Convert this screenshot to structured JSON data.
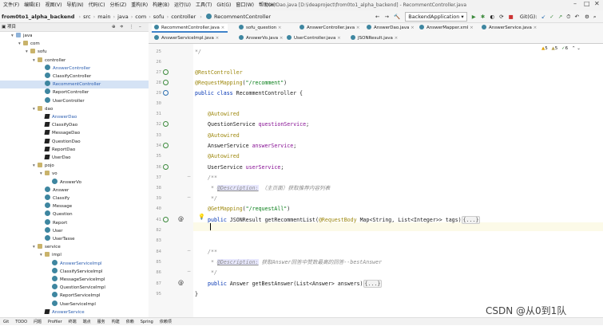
{
  "menubar": {
    "items": [
      "文件(F)",
      "编辑(E)",
      "视图(V)",
      "导航(N)",
      "代码(C)",
      "分析(Z)",
      "重构(R)",
      "构建(B)",
      "运行(U)",
      "工具(T)",
      "Git(G)",
      "窗口(W)",
      "帮助(H)"
    ],
    "window_title": "UserDao.java [D:\\ideaproject\\from0to1_alpha_backend] - RecommentController.java"
  },
  "breadcrumb": {
    "project": "from0to1_alpha_backend",
    "path": [
      "src",
      "main",
      "java",
      "com",
      "sofu",
      "controller"
    ],
    "current": "RecommentController"
  },
  "toolbar": {
    "run_config": "BackendApplication",
    "git_label": "Git(G):"
  },
  "project_panel": {
    "title": "项目",
    "tree": [
      {
        "label": "java",
        "kind": "folder",
        "depth": 0,
        "arrow": "▾"
      },
      {
        "label": "com",
        "kind": "package",
        "depth": 1,
        "arrow": "▾"
      },
      {
        "label": "sofu",
        "kind": "package",
        "depth": 2,
        "arrow": "▾"
      },
      {
        "label": "controller",
        "kind": "package",
        "depth": 3,
        "arrow": "▾"
      },
      {
        "label": "AnswerController",
        "kind": "class",
        "depth": 4,
        "color": "blue"
      },
      {
        "label": "ClassifyController",
        "kind": "class",
        "depth": 4
      },
      {
        "label": "RecommentController",
        "kind": "class",
        "depth": 4,
        "selected": true,
        "color": "blue"
      },
      {
        "label": "ReportController",
        "kind": "class",
        "depth": 4
      },
      {
        "label": "UserController",
        "kind": "class",
        "depth": 4
      },
      {
        "label": "dao",
        "kind": "package",
        "depth": 3,
        "arrow": "▾"
      },
      {
        "label": "AnswerDao",
        "kind": "interface",
        "depth": 4,
        "color": "blue"
      },
      {
        "label": "ClassifyDao",
        "kind": "interface",
        "depth": 4
      },
      {
        "label": "MessageDao",
        "kind": "interface",
        "depth": 4
      },
      {
        "label": "QuestionDao",
        "kind": "interface",
        "depth": 4
      },
      {
        "label": "ReportDao",
        "kind": "interface",
        "depth": 4
      },
      {
        "label": "UserDao",
        "kind": "interface",
        "depth": 4
      },
      {
        "label": "pojo",
        "kind": "package",
        "depth": 3,
        "arrow": "▾"
      },
      {
        "label": "vo",
        "kind": "package",
        "depth": 4,
        "arrow": "▾"
      },
      {
        "label": "AnswerVo",
        "kind": "class",
        "depth": 5
      },
      {
        "label": "Answer",
        "kind": "class",
        "depth": 4
      },
      {
        "label": "Classify",
        "kind": "class",
        "depth": 4
      },
      {
        "label": "Message",
        "kind": "class",
        "depth": 4
      },
      {
        "label": "Question",
        "kind": "class",
        "depth": 4
      },
      {
        "label": "Report",
        "kind": "class",
        "depth": 4
      },
      {
        "label": "User",
        "kind": "class",
        "depth": 4
      },
      {
        "label": "UserTasse",
        "kind": "class",
        "depth": 4
      },
      {
        "label": "service",
        "kind": "package",
        "depth": 3,
        "arrow": "▾"
      },
      {
        "label": "impl",
        "kind": "package",
        "depth": 4,
        "arrow": "▾"
      },
      {
        "label": "AnswerServiceImpl",
        "kind": "class",
        "depth": 5,
        "color": "blue"
      },
      {
        "label": "ClassifyServiceImpl",
        "kind": "class",
        "depth": 5
      },
      {
        "label": "MessageServiceImpl",
        "kind": "class",
        "depth": 5
      },
      {
        "label": "QuestionServiceImpl",
        "kind": "class",
        "depth": 5
      },
      {
        "label": "ReportServiceImpl",
        "kind": "class",
        "depth": 5
      },
      {
        "label": "UserServiceImpl",
        "kind": "class",
        "depth": 5
      },
      {
        "label": "AnswerService",
        "kind": "interface",
        "depth": 4,
        "color": "blue"
      }
    ]
  },
  "editor_tabs": {
    "row1": [
      "RecommentController.java",
      "sofu_question",
      "AnswerController.java",
      "AnswerDao.java",
      "AnswerMapper.xml",
      "AnswerService.java"
    ],
    "row2": [
      "AnswerServiceImpl.java",
      "AnswerVo.java",
      "UserController.java",
      "JSONResult.java"
    ],
    "active": "RecommentController.java"
  },
  "inspection": {
    "warnings": "5",
    "weak_warnings": "5",
    "typos": "6"
  },
  "code_lines": [
    {
      "n": "25",
      "html": "*/",
      "indent": 0,
      "cls": "cmt"
    },
    {
      "n": "26",
      "html": "",
      "indent": 0
    },
    {
      "n": "27",
      "html": "<span class='ann'>@RestController</span>",
      "indent": 0
    },
    {
      "n": "28",
      "html": "<span class='ann'>@RequestMapping</span>(<span class='str'>\"/recomment\"</span>)",
      "indent": 0
    },
    {
      "n": "29",
      "html": "<span class='kw'>public class</span> RecommentController {",
      "indent": 0
    },
    {
      "n": "30",
      "html": "",
      "indent": 0
    },
    {
      "n": "31",
      "html": "<span class='ann'>@Autowired</span>",
      "indent": 1
    },
    {
      "n": "32",
      "html": "QuestionService <span class='fld'>questionService</span>;",
      "indent": 1
    },
    {
      "n": "33",
      "html": "<span class='ann'>@Autowired</span>",
      "indent": 1
    },
    {
      "n": "34",
      "html": "AnswerService <span class='fld'>answerService</span>;",
      "indent": 1
    },
    {
      "n": "35",
      "html": "<span class='ann'>@Autowired</span>",
      "indent": 1
    },
    {
      "n": "36",
      "html": "UserService <span class='fld'>userService</span>;",
      "indent": 1
    },
    {
      "n": "37",
      "html": "<span class='cmt'>/**</span>",
      "indent": 1
    },
    {
      "n": "38",
      "html": "<span class='cmt'> * </span><span class='tag'>@Description:</span><span class='cmt'> （主页面）获取推荐内容列表</span>",
      "indent": 1
    },
    {
      "n": "39",
      "html": "<span class='cmt'> */</span>",
      "indent": 1
    },
    {
      "n": "40",
      "html": "<span class='ann'>@GetMapping</span>(<span class='str'>\"/requestAll\"</span>)",
      "indent": 1
    },
    {
      "n": "41",
      "html": "<span class='kw'>public</span> JSONResult getRecommentList(<span class='ann'>@RequestBody</span> Map&lt;String, List&lt;Integer&gt;&gt; tags)<span class='fold'>{...}</span>",
      "indent": 1
    },
    {
      "n": "82",
      "html": "",
      "indent": 0
    },
    {
      "n": "83",
      "html": "",
      "indent": 0
    },
    {
      "n": "84",
      "html": "<span class='cmt'>/**</span>",
      "indent": 1
    },
    {
      "n": "85",
      "html": "<span class='cmt'> * </span><span class='tag'>@Description:</span><span class='cmt'> 获取Answer回答中赞数最高的回答--bestAnswer</span>",
      "indent": 1
    },
    {
      "n": "86",
      "html": "<span class='cmt'> */</span>",
      "indent": 1
    },
    {
      "n": "87",
      "html": "<span class='kw'>public</span> Answer getBestAnswer(List&lt;Answer&gt; answers)<span class='fold'>{...}</span>",
      "indent": 1
    },
    {
      "n": "95",
      "html": "}",
      "indent": 0
    }
  ],
  "statusbar": {
    "items": [
      "Git",
      "TODO",
      "问题",
      "Profiler",
      "终端",
      "端点",
      "服务",
      "构建",
      "依赖",
      "Spring",
      "依赖项"
    ]
  },
  "watermark": "CSDN @从0到1队",
  "colors": {
    "accent": "#4083c9",
    "annotation": "#9e880d",
    "keyword": "#0033b3",
    "field": "#871094",
    "string": "#067d17"
  }
}
